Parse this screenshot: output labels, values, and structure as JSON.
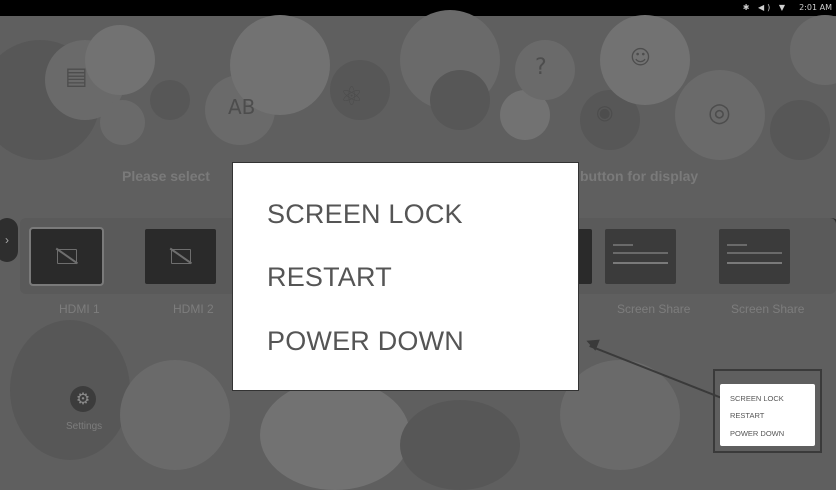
{
  "status_bar": {
    "icons": [
      "bluetooth-icon",
      "volume-icon",
      "wifi-icon"
    ],
    "icon_glyphs": "✱ ◀) ▼",
    "time": "2:01 AM"
  },
  "background": {
    "prompt_left": "Please select",
    "prompt_right": "button for display"
  },
  "sources": [
    {
      "label": "HDMI 1",
      "type": "hdmi",
      "selected": true
    },
    {
      "label": "HDMI 2",
      "type": "hdmi",
      "selected": false
    },
    {
      "label": "Screen Share",
      "type": "share"
    },
    {
      "label": "Screen Share",
      "type": "share"
    }
  ],
  "settings": {
    "label": "Settings",
    "icon": "gear-icon",
    "glyph": "⚙"
  },
  "nav": {
    "left_glyph": "›",
    "right_glyph": "‹"
  },
  "power_dialog": {
    "items": [
      "SCREEN LOCK",
      "RESTART",
      "POWER DOWN"
    ]
  },
  "mini_menu": {
    "items": [
      "SCREEN LOCK",
      "RESTART",
      "POWER DOWN"
    ]
  },
  "colors": {
    "overlay_bg": "#5f5f5f",
    "dialog_bg": "#ffffff",
    "dialog_text": "#555555"
  }
}
